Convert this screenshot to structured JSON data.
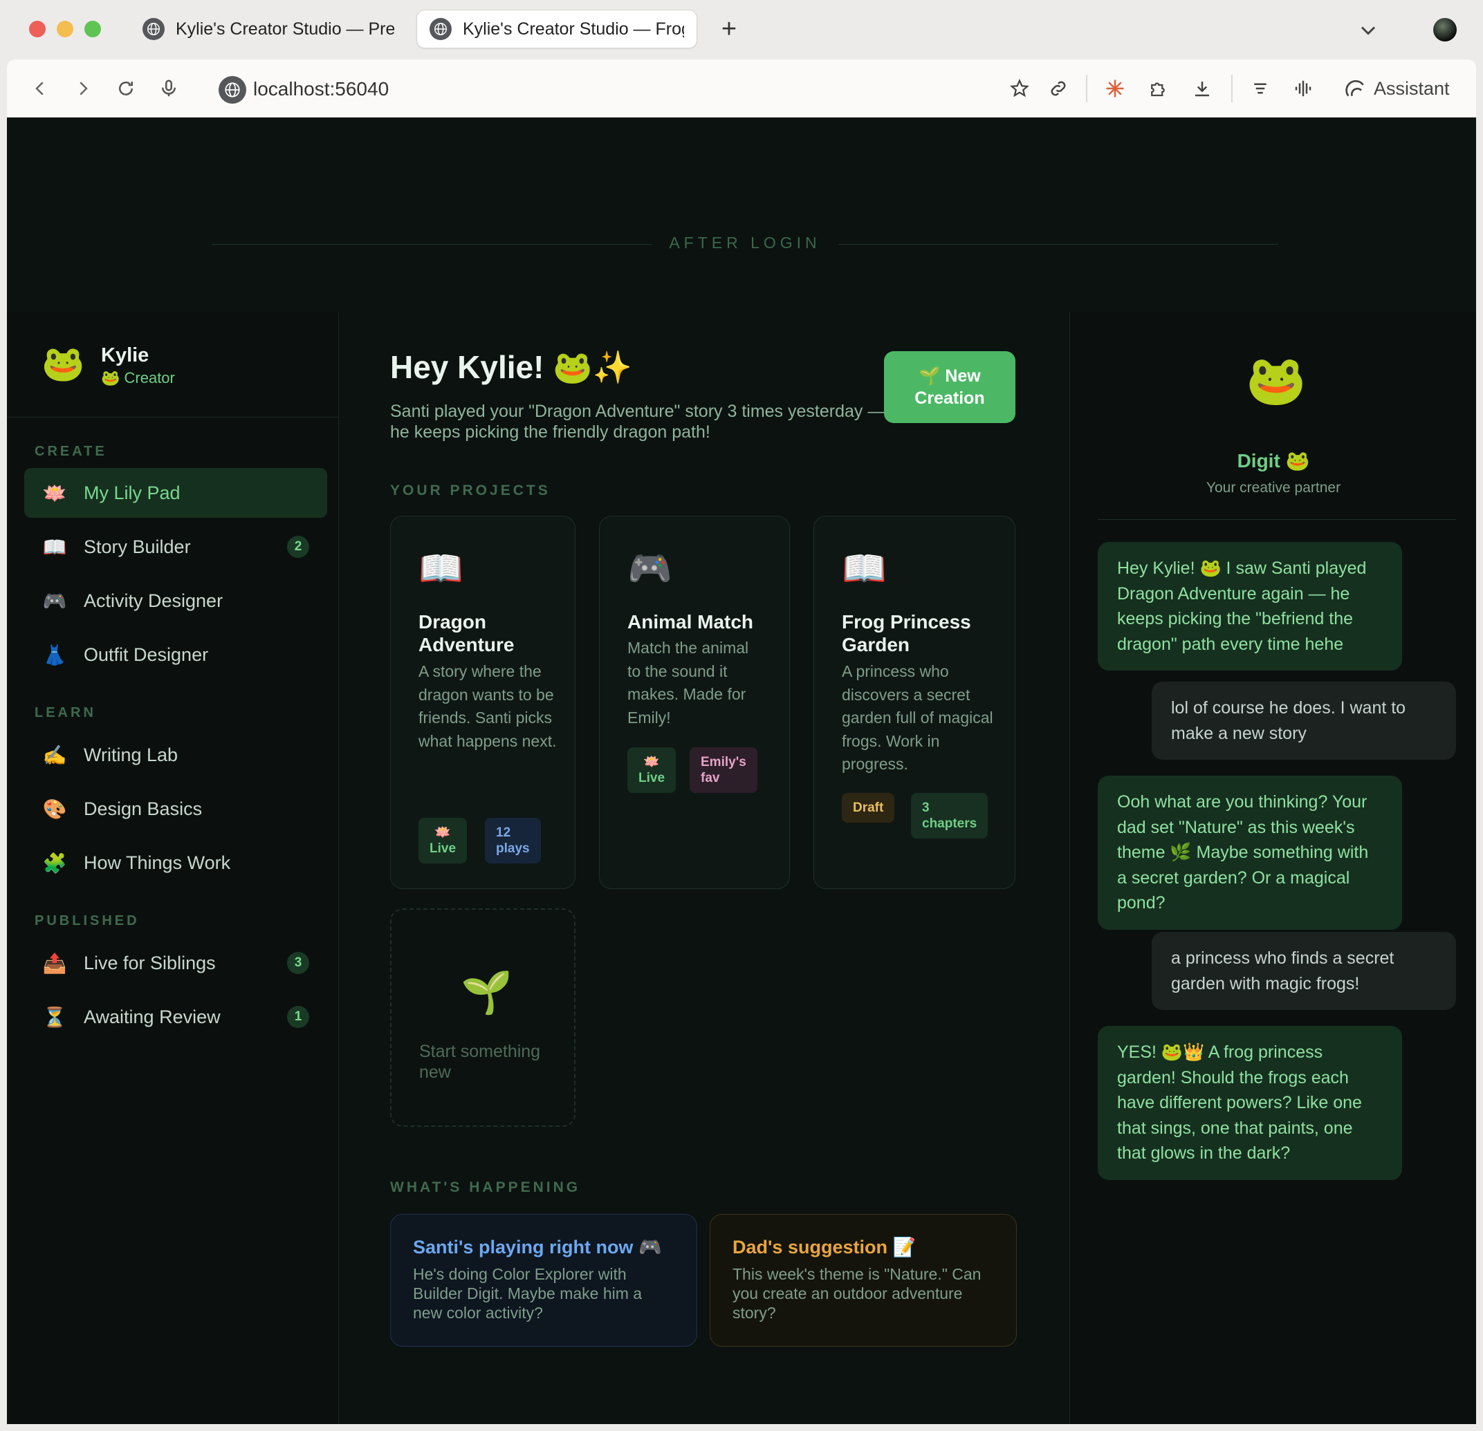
{
  "browser": {
    "tabs": [
      {
        "title": "Kylie's Creator Studio — Preview",
        "active": false
      },
      {
        "title": "Kylie's Creator Studio — Frog Princess Garden",
        "active": true
      }
    ],
    "new_tab_label": "+",
    "url": "localhost:56040",
    "assistant_label": "Assistant",
    "icons": [
      "back-icon",
      "forward-icon",
      "reload-icon",
      "mic-icon",
      "bookmark-star-icon",
      "link-icon",
      "burst-icon",
      "extension-icon",
      "download-icon",
      "menu-lines-icon",
      "audio-wave-icon",
      "assistant-icon"
    ]
  },
  "banner": {
    "label": "AFTER LOGIN"
  },
  "sidebar": {
    "user": {
      "avatar": "🐸",
      "name": "Kylie",
      "role": "🐸 Creator"
    },
    "sections": [
      {
        "title": "CREATE",
        "items": [
          {
            "icon": "🪷",
            "label": "My Lily Pad",
            "active": true
          },
          {
            "icon": "📖",
            "label": "Story Builder",
            "badge": "2"
          },
          {
            "icon": "🎮",
            "label": "Activity Designer"
          },
          {
            "icon": "👗",
            "label": "Outfit Designer"
          }
        ]
      },
      {
        "title": "LEARN",
        "items": [
          {
            "icon": "✍️",
            "label": "Writing Lab"
          },
          {
            "icon": "🎨",
            "label": "Design Basics"
          },
          {
            "icon": "🧩",
            "label": "How Things Work"
          }
        ]
      },
      {
        "title": "PUBLISHED",
        "items": [
          {
            "icon": "📤",
            "label": "Live for Siblings",
            "badge": "3"
          },
          {
            "icon": "⏳",
            "label": "Awaiting Review",
            "badge": "1"
          }
        ]
      }
    ]
  },
  "main": {
    "greeting": "Hey Kylie! 🐸✨",
    "subtitle": "Santi played your \"Dragon Adventure\" story 3 times yesterday — he keeps picking the friendly dragon path!",
    "new_button": {
      "line1": "🌱 New",
      "line2": "Creation"
    },
    "projects_title": "YOUR PROJECTS",
    "projects": [
      {
        "icon": "📖",
        "title": "Dragon Adventure",
        "description": "A story where the dragon wants to be friends. Santi picks what happens next.",
        "chips": [
          {
            "line1": "🪷",
            "line2": "Live"
          },
          {
            "line1": "12",
            "line2": "plays"
          }
        ]
      },
      {
        "icon": "🎮",
        "title": "Animal Match",
        "description": "Match the animal to the sound it makes. Made for Emily!",
        "chips": [
          {
            "line1": "🪷",
            "line2": "Live"
          },
          {
            "line1": "Emily's",
            "line2": "fav"
          }
        ]
      },
      {
        "icon": "📖",
        "title": "Frog Princess Garden",
        "description": "A princess who discovers a secret garden full of magical frogs. Work in progress.",
        "chips": [
          {
            "line1": "Draft"
          },
          {
            "line1": "3",
            "line2": "chapters"
          }
        ]
      }
    ],
    "start_new": {
      "icon": "🌱",
      "label": "Start something new"
    },
    "happening_title": "WHAT'S HAPPENING",
    "happening": [
      {
        "title": "Santi's playing right now 🎮",
        "body": "He's doing Color Explorer with Builder Digit. Maybe make him a new color activity?"
      },
      {
        "title": "Dad's suggestion 📝",
        "body": "This week's theme is \"Nature.\" Can you create an outdoor adventure story?"
      }
    ]
  },
  "chat": {
    "avatar": "🐸",
    "name": "Digit 🐸",
    "subtitle": "Your creative partner",
    "messages": [
      {
        "from": "bot",
        "text": "Hey Kylie! 🐸 I saw Santi played Dragon Adventure again — he keeps picking the \"befriend the dragon\" path every time hehe"
      },
      {
        "from": "user",
        "text": "lol of course he does. I want to make a new story"
      },
      {
        "from": "bot",
        "text": "Ooh what are you thinking? Your dad set \"Nature\" as this week's theme 🌿 Maybe something with a secret garden? Or a magical pond?"
      },
      {
        "from": "user",
        "text": "a princess who finds a secret garden with magic frogs!"
      },
      {
        "from": "bot",
        "text": "YES! 🐸👑 A frog princess garden! Should the frogs each have different powers? Like one that sings, one that paints, one that glows in the dark?"
      }
    ]
  },
  "colors": {
    "accent_green": "#4cb865",
    "page_bg": "#0c1210",
    "link_blue": "#6ca8f0",
    "amber": "#e8a540"
  }
}
